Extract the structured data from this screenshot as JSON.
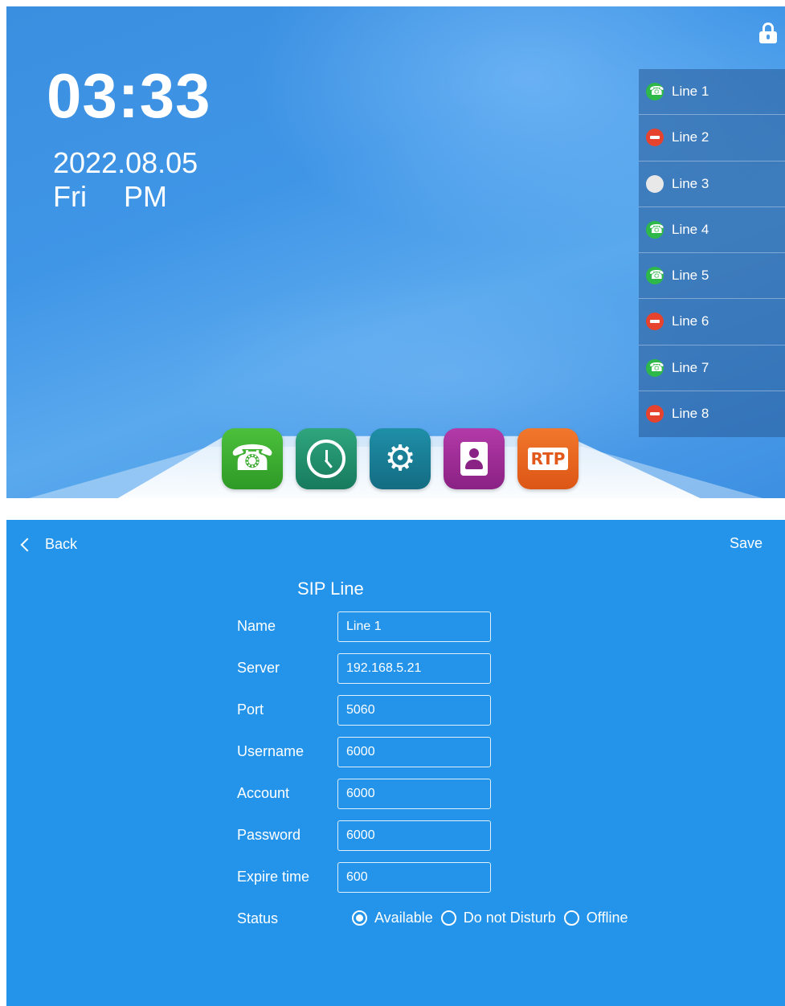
{
  "home": {
    "time": "03:33",
    "date": "2022.08.05",
    "weekday": "Fri",
    "meridiem": "PM",
    "lock_icon": "lock-icon",
    "lines": [
      {
        "label": "Line 1",
        "status": "online",
        "icon": "phone-icon",
        "color": "#2eb84a"
      },
      {
        "label": "Line 2",
        "status": "do-not-disturb",
        "icon": "minus-circle-icon",
        "color": "#e5432e"
      },
      {
        "label": "Line 3",
        "status": "offline",
        "icon": "gray-circle-icon",
        "color": "#e8e8e8"
      },
      {
        "label": "Line 4",
        "status": "online",
        "icon": "phone-icon",
        "color": "#2eb84a"
      },
      {
        "label": "Line 5",
        "status": "online",
        "icon": "phone-icon",
        "color": "#2eb84a"
      },
      {
        "label": "Line 6",
        "status": "do-not-disturb",
        "icon": "minus-circle-icon",
        "color": "#e5432e"
      },
      {
        "label": "Line 7",
        "status": "online",
        "icon": "phone-icon",
        "color": "#2eb84a"
      },
      {
        "label": "Line 8",
        "status": "do-not-disturb",
        "icon": "minus-circle-icon",
        "color": "#e5432e"
      }
    ],
    "dock": [
      {
        "app": "phone",
        "icon": "phone-app-icon",
        "color": "#3aae30"
      },
      {
        "app": "clock",
        "icon": "clock-app-icon",
        "color": "#22906c"
      },
      {
        "app": "settings",
        "icon": "settings-gears-icon",
        "color": "#1a7f96"
      },
      {
        "app": "contacts",
        "icon": "contacts-book-icon",
        "color": "#a02f98"
      },
      {
        "app": "rtp",
        "icon": "rtp-icon",
        "label": "RTP",
        "color": "#ea6820"
      }
    ]
  },
  "sip": {
    "back_label": "Back",
    "save_label": "Save",
    "title": "SIP Line",
    "fields": {
      "name": {
        "label": "Name",
        "value": "Line 1"
      },
      "server": {
        "label": "Server",
        "value": "192.168.5.21"
      },
      "port": {
        "label": "Port",
        "value": "5060"
      },
      "username": {
        "label": "Username",
        "value": "6000"
      },
      "account": {
        "label": "Account",
        "value": "6000"
      },
      "password": {
        "label": "Password",
        "value": "6000"
      },
      "expire": {
        "label": "Expire time",
        "value": "600"
      }
    },
    "status": {
      "label": "Status",
      "options": [
        "Available",
        "Do not Disturb",
        "Offline"
      ],
      "selected": "Available"
    },
    "background_color": "#2494ea"
  }
}
